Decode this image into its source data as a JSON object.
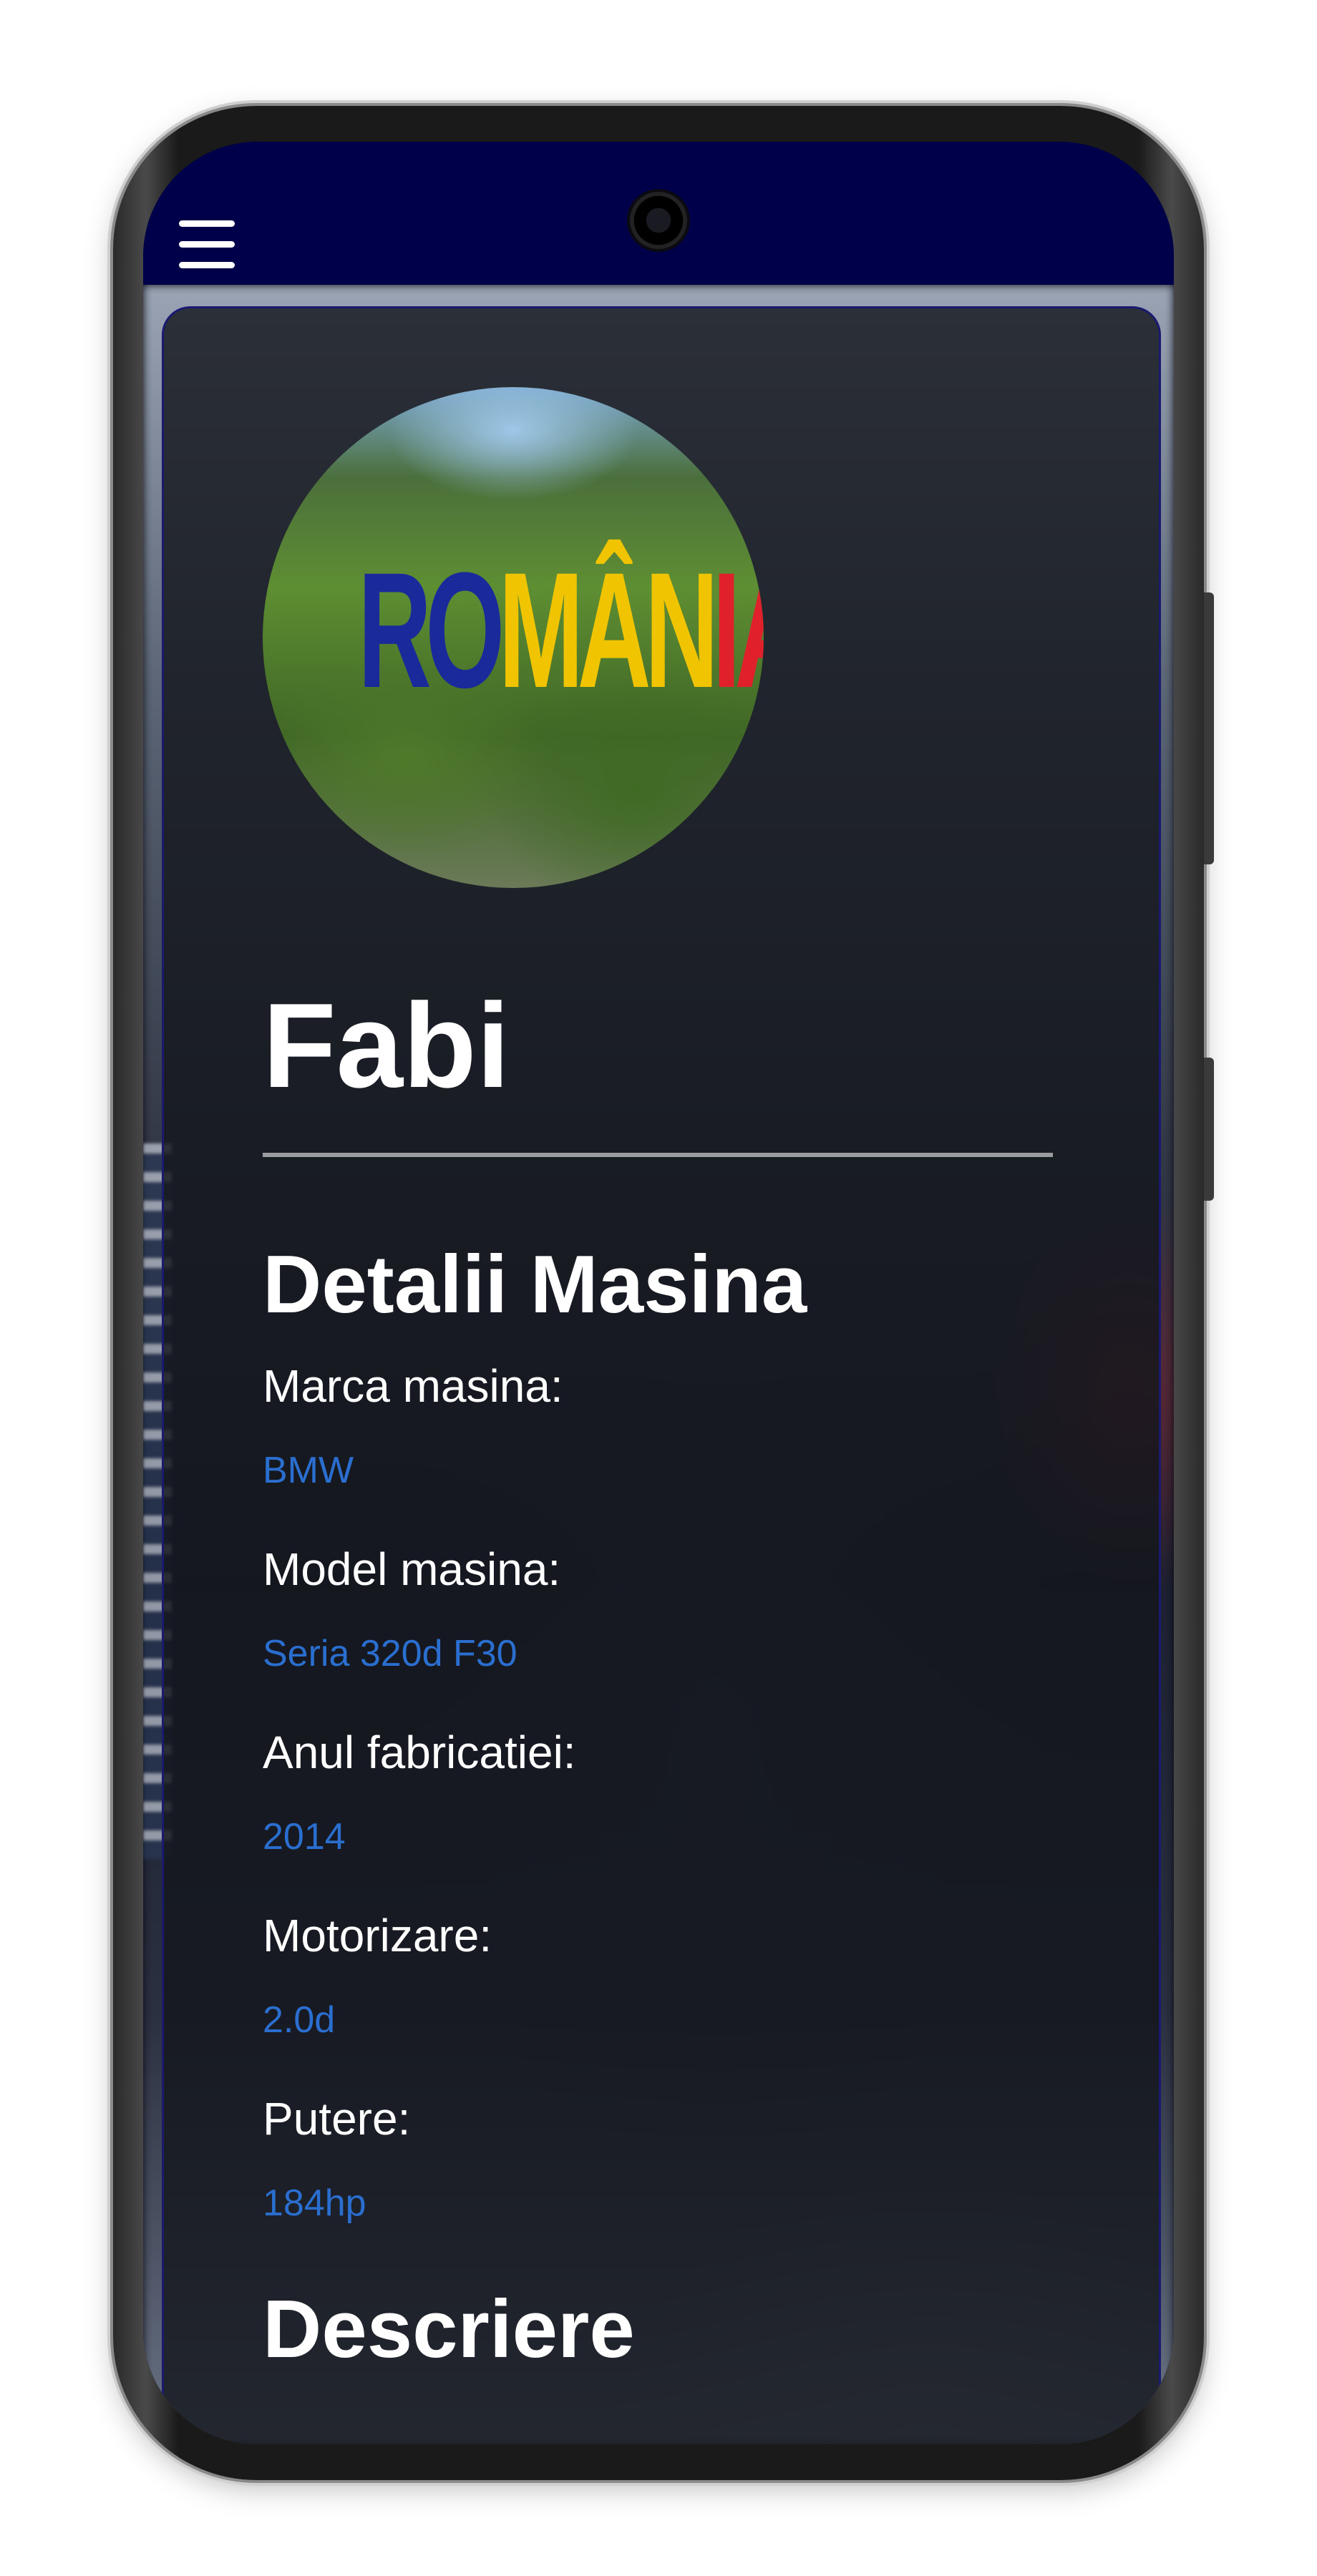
{
  "profile": {
    "avatar_text": "ROMÂNIA",
    "name": "Fabi"
  },
  "details": {
    "title": "Detalii Masina",
    "fields": [
      {
        "label": "Marca masina:",
        "value": "BMW"
      },
      {
        "label": "Model masina:",
        "value": "Seria 320d F30"
      },
      {
        "label": "Anul fabricatiei:",
        "value": "2014"
      },
      {
        "label": "Motorizare:",
        "value": "2.0d"
      },
      {
        "label": "Putere:",
        "value": "184hp"
      }
    ]
  },
  "description": {
    "title": "Descriere"
  },
  "colors": {
    "topbar": "#00004a",
    "value_text": "#2a6fd0",
    "card_border": "#1a1a70"
  },
  "icons": [
    "menu-icon"
  ]
}
